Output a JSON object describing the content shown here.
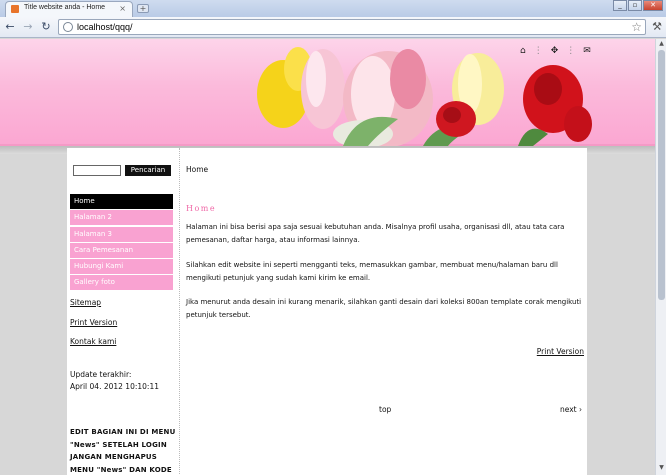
{
  "browser": {
    "tab_title": "Title website anda - Home",
    "tab_close": "×",
    "new_tab": "+",
    "url": "localhost/qqq/",
    "window_buttons": [
      "_",
      "▫",
      "✕"
    ]
  },
  "page": {
    "search_button": "Pencarian",
    "search_value": "",
    "menu": [
      {
        "label": "Home"
      },
      {
        "label": "Halaman 2"
      },
      {
        "label": "Halaman 3"
      },
      {
        "label": "Cara Pemesanan"
      },
      {
        "label": "Hubungi Kami"
      },
      {
        "label": "Gallery foto"
      }
    ],
    "sitemap": "Sitemap",
    "print_version": "Print Version",
    "contact": "Kontak kami",
    "update_label": "Update terakhir:",
    "update_value": "April 04. 2012 10:10:11",
    "edit_note": "EDIT BAGIAN INI DI MENU \"News\" SETELAH LOGIN JANGAN MENGHAPUS MENU \"News\" DAN KODE",
    "breadcrumb": "Home",
    "heading": "Home",
    "para1": "Halaman ini bisa berisi apa saja sesuai kebutuhan anda. Misalnya profil usaha, organisasi dll, atau tata cara pemesanan, daftar harga, atau informasi lainnya.",
    "para2": "Silahkan edit website ini seperti mengganti teks, memasukkan gambar, membuat menu/halaman baru dll mengikuti petunjuk yang sudah kami kirim ke email.",
    "para3": "Jika menurut anda desain ini kurang menarik, silahkan ganti desain dari koleksi 800an template corak mengikuti petunjuk tersebut.",
    "print_version_bottom": "Print Version",
    "top_link": "top",
    "next_link": "next ›"
  },
  "colors": {
    "menu_pink": "#f9a2d1",
    "heading_pink": "#f06aa8",
    "header_pink": "#fbbadb"
  }
}
